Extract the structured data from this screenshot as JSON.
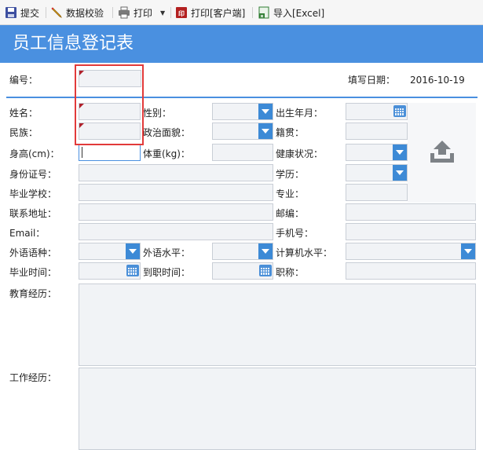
{
  "toolbar": {
    "submit": "提交",
    "validate": "数据校验",
    "print": "打印",
    "print_client": "打印[客户端]",
    "import_excel": "导入[Excel]"
  },
  "form": {
    "title": "员工信息登记表",
    "labels": {
      "number": "编号：",
      "fill_date": "填写日期：",
      "name": "姓名：",
      "gender": "性别：",
      "birth": "出生年月：",
      "ethnicity": "民族：",
      "politics": "政治面貌：",
      "native_place": "籍贯：",
      "height": "身高(cm)：",
      "weight": "体重(kg)：",
      "health": "健康状况：",
      "id_number": "身份证号：",
      "education": "学历：",
      "school": "毕业学校：",
      "major": "专业：",
      "address": "联系地址：",
      "postcode": "邮编：",
      "email": "Email：",
      "mobile": "手机号：",
      "lang_type": "外语语种：",
      "lang_level": "外语水平：",
      "computer_level": "计算机水平：",
      "grad_time": "毕业时间：",
      "join_time": "到职时间：",
      "title_rank": "职称：",
      "edu_history": "教育经历：",
      "work_history": "工作经历："
    },
    "values": {
      "fill_date": "2016-10-19"
    }
  }
}
